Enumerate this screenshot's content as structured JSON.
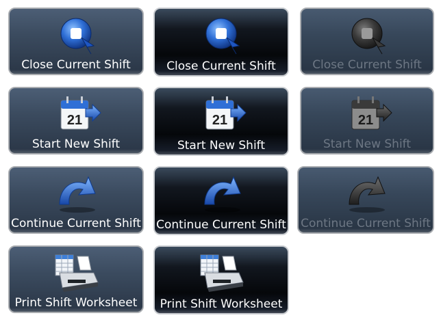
{
  "buttons": {
    "close_shift": {
      "label": "Close Current Shift",
      "icon": "stop-cursor-icon"
    },
    "start_shift": {
      "label": "Start New Shift",
      "icon": "calendar-arrow-icon",
      "calendar_day": "21"
    },
    "continue_shift": {
      "label": "Continue Current Shift",
      "icon": "redo-arrow-icon"
    },
    "print_worksheet": {
      "label": "Print Shift Worksheet",
      "icon": "printer-icon"
    }
  },
  "colors": {
    "icon_blue": "#2f6fd6",
    "disabled_text": "#6d7784"
  }
}
